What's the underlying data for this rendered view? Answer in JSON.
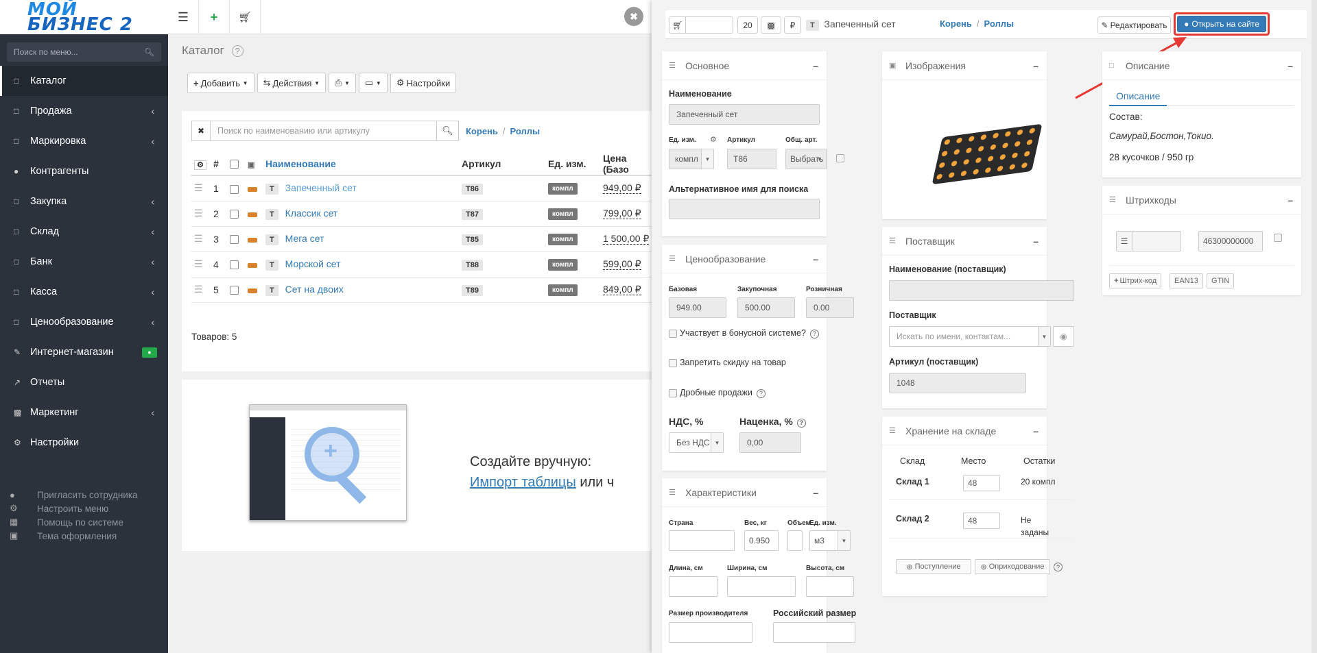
{
  "sidebar": {
    "logo_line1": "МОЙ",
    "logo_line2": "БИЗНЕС 2",
    "search_placeholder": "Поиск по меню...",
    "items": [
      {
        "label": "Каталог"
      },
      {
        "label": "Продажа"
      },
      {
        "label": "Маркировка"
      },
      {
        "label": "Контрагенты"
      },
      {
        "label": "Закупка"
      },
      {
        "label": "Склад"
      },
      {
        "label": "Банк"
      },
      {
        "label": "Касса"
      },
      {
        "label": "Ценообразование"
      },
      {
        "label": "Интернет-магазин"
      },
      {
        "label": "Отчеты"
      },
      {
        "label": "Маркетинг"
      },
      {
        "label": "Настройки"
      }
    ],
    "bottom": [
      {
        "label": "Пригласить сотрудника"
      },
      {
        "label": "Настроить меню"
      },
      {
        "label": "Помощь по системе"
      },
      {
        "label": "Тема оформления"
      }
    ]
  },
  "main": {
    "title": "Каталог",
    "toolbar": {
      "add": "Добавить",
      "actions": "Действия",
      "settings": "Настройки"
    },
    "search_placeholder": "Поиск по наименованию или артикулу",
    "breadcrumb": {
      "root": "Корень",
      "current": "Роллы"
    },
    "columns": {
      "num": "#",
      "name": "Наименование",
      "article": "Артикул",
      "unit": "Ед. изм.",
      "price": "Цена (Базо"
    },
    "rows": [
      {
        "n": "1",
        "type": "T",
        "name": "Запеченный сет",
        "article": "T86",
        "unit": "компл",
        "price": "949,00 ₽"
      },
      {
        "n": "2",
        "type": "T",
        "name": "Классик сет",
        "article": "T87",
        "unit": "компл",
        "price": "799,00 ₽"
      },
      {
        "n": "3",
        "type": "T",
        "name": "Мега сет",
        "article": "T85",
        "unit": "компл",
        "price": "1 500,00 ₽"
      },
      {
        "n": "4",
        "type": "T",
        "name": "Морской сет",
        "article": "T88",
        "unit": "компл",
        "price": "599,00 ₽"
      },
      {
        "n": "5",
        "type": "T",
        "name": "Сет на двоих",
        "article": "T89",
        "unit": "компл",
        "price": "849,00 ₽"
      }
    ],
    "count": "Товаров: 5",
    "empty_line1": "Создайте вручную:",
    "empty_import": "Импорт таблицы",
    "empty_or": "или ч"
  },
  "modal": {
    "header": {
      "qty": "20",
      "type": "T",
      "title": "Запеченный сет",
      "breadcrumb_root": "Корень",
      "breadcrumb_current": "Роллы",
      "edit": "Редактировать",
      "open_site": "Открыть на сайте",
      "currency": "₽"
    },
    "basic": {
      "title": "Основное",
      "name_label": "Наименование",
      "name_value": "Запеченный сет",
      "unit_label": "Ед. изм.",
      "unit_value": "компл",
      "article_label": "Артикул",
      "article_value": "T86",
      "common_label": "Общ. арт.",
      "common_value": "Выбрать",
      "alt_label": "Альтернативное имя для поиска"
    },
    "pricing": {
      "title": "Ценообразование",
      "base_label": "Базовая",
      "base_value": "949.00",
      "purchase_label": "Закупочная",
      "purchase_value": "500.00",
      "retail_label": "Розничная",
      "retail_value": "0.00",
      "bonus": "Участвует в бонусной системе?",
      "no_discount": "Запретить скидку на товар",
      "fractional": "Дробные продажи",
      "vat_label": "НДС, %",
      "vat_value": "Без НДС",
      "markup_label": "Наценка, %",
      "markup_value": "0,00"
    },
    "specs": {
      "title": "Характеристики",
      "country": "Страна",
      "weight": "Вес, кг",
      "weight_value": "0.950",
      "volume": "Объем",
      "unit": "Ед. изм.",
      "unit_value": "м3",
      "length": "Длина, см",
      "width": "Ширина, см",
      "height": "Высота, см",
      "maker_size": "Размер производителя",
      "ru_size": "Российский размер"
    },
    "images": {
      "title": "Изображения"
    },
    "supplier": {
      "title": "Поставщик",
      "name_label": "Наименование (поставщик)",
      "supplier_label": "Поставщик",
      "supplier_placeholder": "Искать по имени, контактам...",
      "article_label": "Артикул (поставщик)",
      "article_value": "1048"
    },
    "storage": {
      "title": "Хранение на складе",
      "col_wh": "Склад",
      "col_place": "Место",
      "col_rest": "Остатки",
      "rows": [
        {
          "wh": "Склад 1",
          "place": "48",
          "rest": "20 компл"
        },
        {
          "wh": "Склад 2",
          "place": "48",
          "rest": "Не заданы"
        }
      ],
      "receive": "Поступление",
      "writeoff": "Оприходование"
    },
    "description": {
      "title": "Описание",
      "tab": "Описание",
      "line1": "Состав:",
      "line2": "Самурай,Бостон,Токио.",
      "line3": "28 кусочков / 950 гр"
    },
    "barcodes": {
      "title": "Штрихкоды",
      "value": "46300000000",
      "add": "Штрих-код",
      "ean": "EAN13",
      "gtin": "GTIN"
    }
  },
  "colors": {
    "sidebar": "#2b323c",
    "accent": "#337ab7",
    "highlight": "#e53935"
  }
}
